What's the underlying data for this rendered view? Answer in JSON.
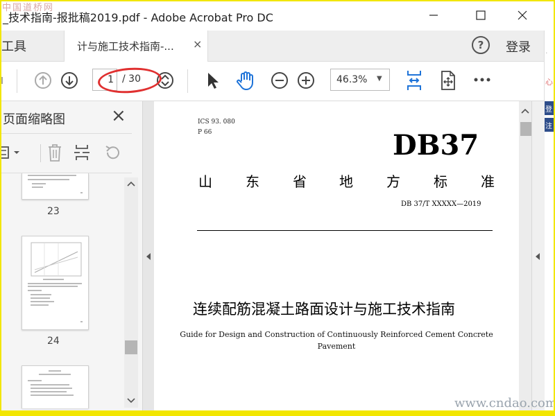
{
  "watermark_top": "中国道桥网",
  "title": "_技术指南-报批稿2019.pdf - Adobe Acrobat Pro DC",
  "window_controls": [
    "minimize",
    "maximize",
    "close"
  ],
  "tabs": {
    "tools_label": "工具",
    "doc_tab_label": "计与施工技术指南-...",
    "doc_tab_close": "×"
  },
  "header": {
    "help": "?",
    "login": "登录"
  },
  "toolbar": {
    "current_page": "1",
    "total_pages": "/ 30",
    "zoom": "46.3%"
  },
  "thumbnails_panel": {
    "title": "页面缩略图",
    "close": "×",
    "pages": [
      "23",
      "24"
    ]
  },
  "document": {
    "ics": "ICS   93. 080",
    "ccs": "P  66",
    "code": "DB37",
    "standard_chars": [
      "山",
      "东",
      "省",
      "地",
      "方",
      "标",
      "准"
    ],
    "standard_number": "DB 37/T  XXXXX—2019",
    "title_cn": "连续配筋混凝土路面设计与施工技术指南",
    "title_en_line1": "Guide for Design and Construction of Continuously Reinforced Cement Concrete",
    "title_en_line2": "Pavement"
  },
  "right_side_fragments": [
    "心",
    "登陆",
    "注册"
  ],
  "watermark_bottom": "www.cndao.com"
}
